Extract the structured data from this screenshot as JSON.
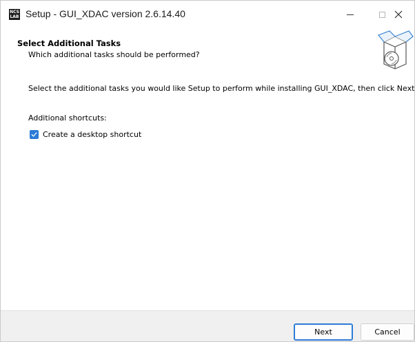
{
  "window": {
    "title": "Setup - GUI_XDAC version 2.6.14.40",
    "app_icon": {
      "name": "ncslab-logo-icon",
      "line1": "NCS",
      "line2": "LAB"
    },
    "controls": {
      "minimize": "minimize-icon",
      "maximize": "maximize-icon",
      "close": "close-icon"
    }
  },
  "header": {
    "title": "Select Additional Tasks",
    "subtitle": "Which additional tasks should be performed?",
    "icon": "setup-box-icon"
  },
  "body": {
    "description": "Select the additional tasks you would like Setup to perform while installing GUI_XDAC, then click Next.",
    "shortcuts_label": "Additional shortcuts:",
    "tasks": [
      {
        "label": "Create a desktop shortcut",
        "checked": true
      }
    ]
  },
  "footer": {
    "next_label": "Next",
    "cancel_label": "Cancel"
  },
  "colors": {
    "accent": "#2d7bd6",
    "footer_bg": "#f0f0f0"
  }
}
